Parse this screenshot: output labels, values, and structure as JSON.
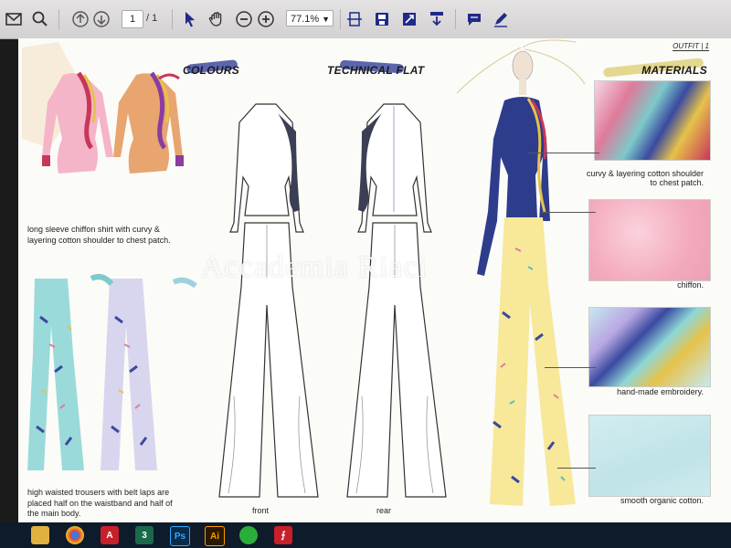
{
  "toolbar": {
    "page_current": "1",
    "page_total": "/ 1",
    "zoom": "77.1%"
  },
  "sheet": {
    "outfit_label": "OUTFIT | 1",
    "headings": {
      "colours": "COLOURS",
      "technical_flat": "TECHNICAL FLAT",
      "materials": "MATERIALS"
    },
    "watermark": "Accademia Riaci",
    "shirt_caption": "long sleeve chiffon shirt with curvy & layering cotton shoulder to chest patch.",
    "trousers_caption": "high waisted trousers with belt laps are placed half on the waistband and half of the main body.",
    "flat_labels": {
      "front": "front",
      "rear": "rear"
    },
    "materials": [
      {
        "caption": "curvy & layering cotton shoulder to chest patch."
      },
      {
        "caption": "chiffon."
      },
      {
        "caption": "hand-made embroidery."
      },
      {
        "caption": "smooth organic cotton."
      }
    ]
  },
  "colors": {
    "toolbar_bg": "#dddbdb",
    "sheet_bg": "#fbfbf8",
    "navy": "#2e3c8c",
    "pink": "#f2b3c6",
    "orange": "#e6a06c",
    "mint": "#8fd8d8",
    "yellow": "#f7e89a",
    "taskbar": "#0d1b2a"
  },
  "icons": [
    "mail-icon",
    "search-icon",
    "arrow-up-circle-icon",
    "arrow-down-circle-icon",
    "cursor-icon",
    "hand-icon",
    "zoom-out-icon",
    "zoom-in-icon",
    "fit-page-icon",
    "save-icon",
    "fullscreen-icon",
    "download-icon",
    "comment-icon",
    "pen-icon"
  ],
  "taskbar": {
    "apps": [
      "folder",
      "chrome",
      "acrobat",
      "3",
      "Ps",
      "Ai",
      "wechat",
      "pdf"
    ]
  }
}
